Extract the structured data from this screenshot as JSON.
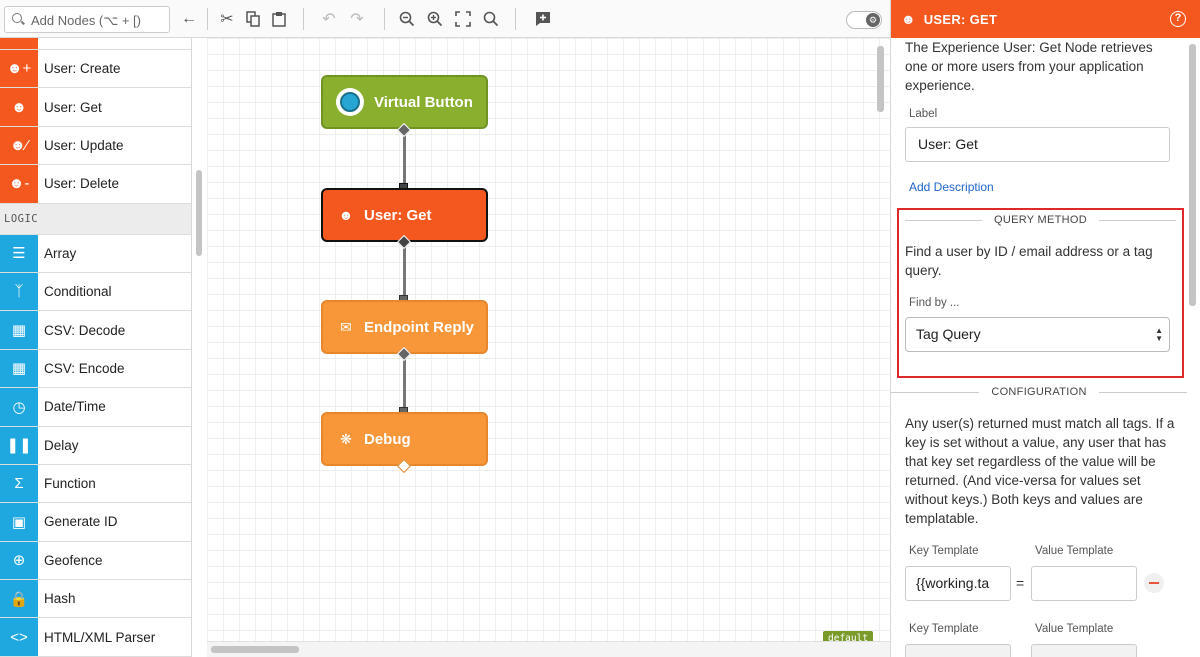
{
  "toolbar": {
    "search_placeholder": "Add Nodes (⌥ + [)"
  },
  "palette": {
    "experience_items": [
      {
        "label": "User: Create",
        "icon": "user-add-icon"
      },
      {
        "label": "User: Get",
        "icon": "user-search-icon"
      },
      {
        "label": "User: Update",
        "icon": "user-edit-icon"
      },
      {
        "label": "User: Delete",
        "icon": "user-remove-icon"
      }
    ],
    "logic_category": "LOGIC",
    "logic_items": [
      {
        "label": "Array",
        "icon": "list-icon"
      },
      {
        "label": "Conditional",
        "icon": "branch-icon"
      },
      {
        "label": "CSV: Decode",
        "icon": "csv-decode-icon"
      },
      {
        "label": "CSV: Encode",
        "icon": "csv-encode-icon"
      },
      {
        "label": "Date/Time",
        "icon": "clock-icon"
      },
      {
        "label": "Delay",
        "icon": "pause-icon"
      },
      {
        "label": "Function",
        "icon": "sigma-icon"
      },
      {
        "label": "Generate ID",
        "icon": "id-card-icon"
      },
      {
        "label": "Geofence",
        "icon": "crosshair-icon"
      },
      {
        "label": "Hash",
        "icon": "lock-icon"
      },
      {
        "label": "HTML/XML Parser",
        "icon": "code-icon"
      }
    ]
  },
  "canvas": {
    "nodes": [
      {
        "label": "Virtual Button",
        "icon": "virtual-button-icon"
      },
      {
        "label": "User: Get",
        "icon": "user-search-icon"
      },
      {
        "label": "Endpoint Reply",
        "icon": "reply-icon"
      },
      {
        "label": "Debug",
        "icon": "bug-icon"
      }
    ],
    "flow_tag": "default"
  },
  "panel": {
    "title": "USER: GET",
    "description": "The Experience User: Get Node retrieves one or more users from your application experience.",
    "label_field_label": "Label",
    "label_field_value": "User: Get",
    "add_description": "Add Description",
    "query_method_title": "QUERY METHOD",
    "query_method_text": "Find a user by ID / email address or a tag query.",
    "find_by_label": "Find by ...",
    "find_by_value": "Tag Query",
    "configuration_title": "CONFIGURATION",
    "configuration_text": "Any user(s) returned must match all tags. If a key is set without a value, any user that has that key set regardless of the value will be returned. (And vice-versa for values set without keys.) Both keys and values are templatable.",
    "key_template_label": "Key Template",
    "value_template_label": "Value Template",
    "key_template_value": "{{working.ta",
    "value_template_value": "",
    "equals": "=",
    "key_template_label_2": "Key Template",
    "value_template_label_2": "Value Template"
  },
  "colors": {
    "experience": "#f4581f",
    "logic": "#1fa8df",
    "trigger": "#8aaf2f",
    "output": "#f7973a",
    "highlight": "#e0282a"
  }
}
